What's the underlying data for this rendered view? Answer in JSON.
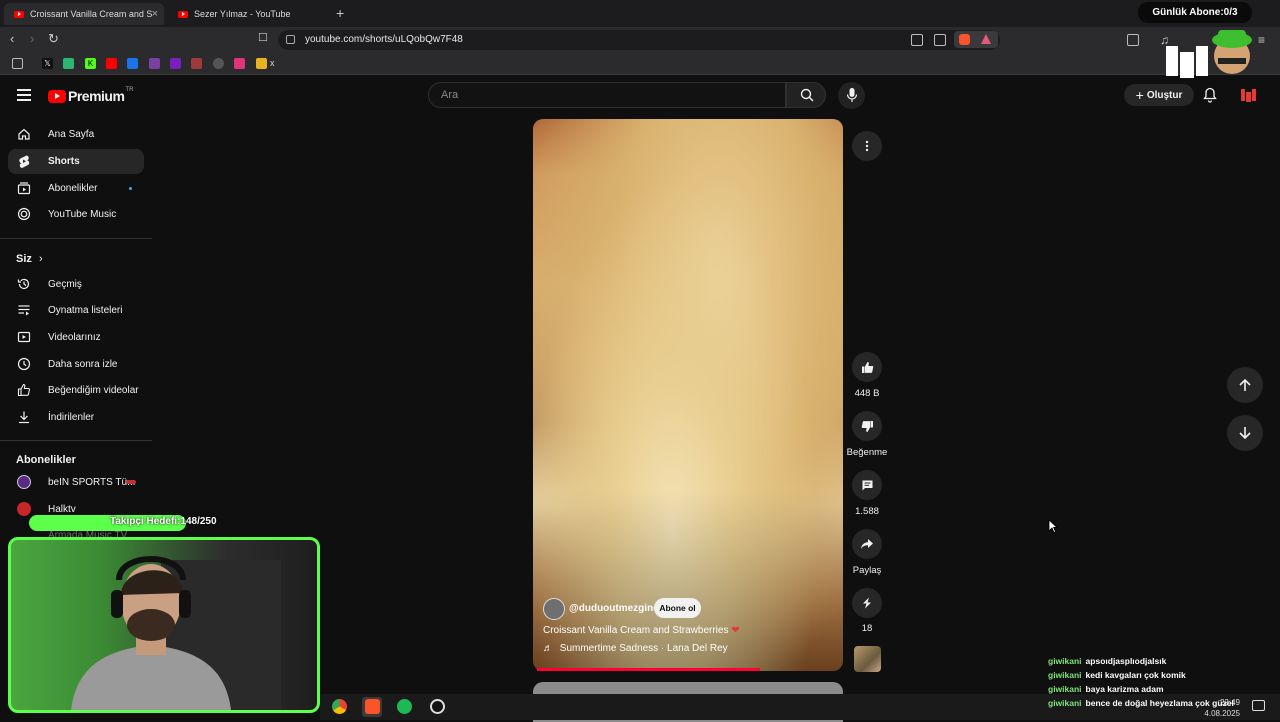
{
  "browser": {
    "tabs": [
      {
        "title": "Croissant Vanilla Cream and S"
      },
      {
        "title": "Sezer Yılmaz - YouTube"
      }
    ],
    "url": "youtube.com/shorts/uLQobQw7F48",
    "bookmark_folder": "x"
  },
  "overlay": {
    "subscriber_goal": "Günlük Abone:0/3",
    "follower_goal": "Takipçi Hedefi:148/250"
  },
  "youtube": {
    "logo_text": "Premium",
    "logo_region": "TR",
    "search_placeholder": "Ara",
    "create_label": "Oluştur"
  },
  "sidebar": {
    "main": [
      {
        "label": "Ana Sayfa",
        "icon": "home-icon"
      },
      {
        "label": "Shorts",
        "icon": "shorts-icon",
        "selected": true
      },
      {
        "label": "Abonelikler",
        "icon": "subscriptions-icon"
      },
      {
        "label": "YouTube Music",
        "icon": "youtube-music-icon"
      }
    ],
    "you_heading": "Siz",
    "you": [
      {
        "label": "Geçmiş",
        "icon": "history-icon"
      },
      {
        "label": "Oynatma listeleri",
        "icon": "playlists-icon"
      },
      {
        "label": "Videolarınız",
        "icon": "your-videos-icon"
      },
      {
        "label": "Daha sonra izle",
        "icon": "watch-later-icon"
      },
      {
        "label": "Beğendiğim videolar",
        "icon": "liked-videos-icon"
      },
      {
        "label": "İndirilenler",
        "icon": "downloads-icon"
      }
    ],
    "subs_heading": "Abonelikler",
    "subs": [
      {
        "label": "beIN SPORTS Tü..."
      },
      {
        "label": "Halktv"
      },
      {
        "label": "Armada Music TV"
      }
    ]
  },
  "short": {
    "channel": "@duduoutmezgine",
    "subscribe_label": "Abone ol",
    "title": "Croissant Vanilla Cream and Strawberries",
    "music": "Summertime Sadness · Lana Del Rey",
    "likes": "448 B",
    "dislike_label": "Beğenme",
    "comments": "1.588",
    "share_label": "Paylaş",
    "remix_count": "18",
    "progress_fraction": 0.73
  },
  "chat": [
    {
      "user": "giwikani",
      "message": "apsoıdjasplıodjalsık"
    },
    {
      "user": "giwikani",
      "message": "kedi kavgaları çok komik"
    },
    {
      "user": "giwikani",
      "message": "baya karizma adam"
    },
    {
      "user": "giwikani",
      "message": "bence de doğal heyezlama çok güzel"
    }
  ],
  "clock": {
    "time": "22:49",
    "date": "4.08.2025"
  },
  "colors": {
    "accent": "#ff0000",
    "overlay_green": "#5cff4a",
    "background": "#0f0f0f"
  }
}
